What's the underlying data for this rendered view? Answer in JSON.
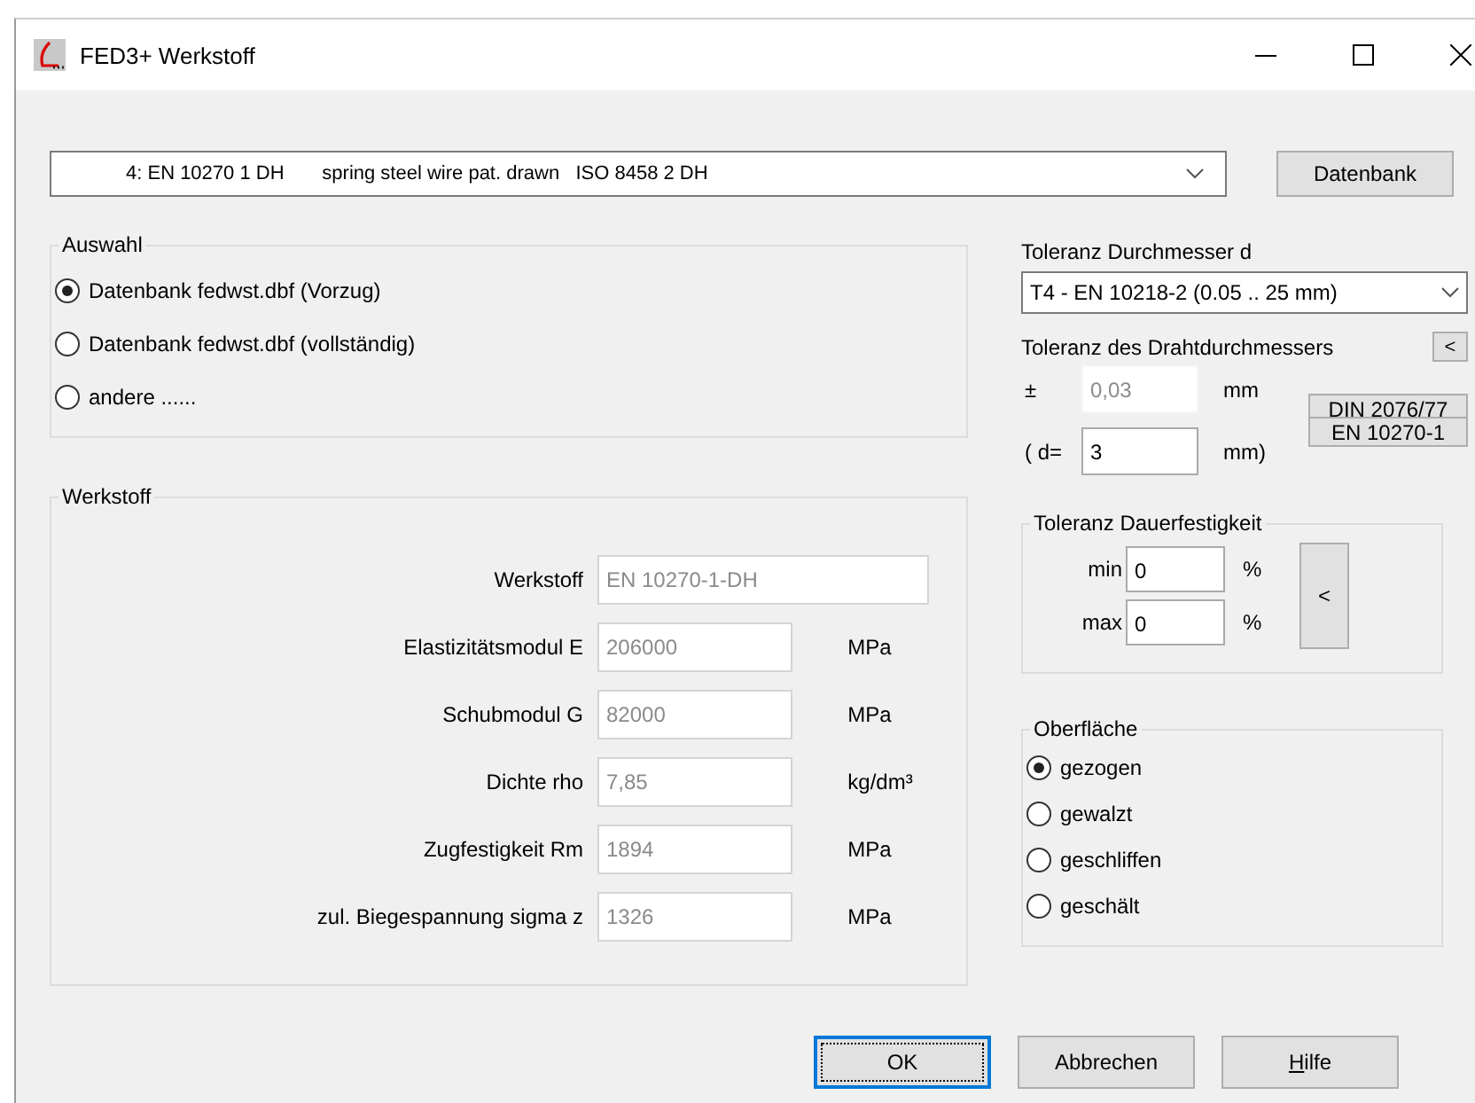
{
  "window": {
    "title": "FED3+ Werkstoff"
  },
  "material_combo": {
    "value": "4: EN 10270 1 DH       spring steel wire pat. drawn   ISO 8458 2 DH"
  },
  "database_button": "Datenbank",
  "auswahl": {
    "title": "Auswahl",
    "options": [
      {
        "label": "Datenbank fedwst.dbf (Vorzug)",
        "selected": true
      },
      {
        "label": "Datenbank fedwst.dbf (vollständig)",
        "selected": false
      },
      {
        "label": "andere ......",
        "selected": false
      }
    ]
  },
  "werkstoff": {
    "title": "Werkstoff",
    "fields": [
      {
        "label": "Werkstoff",
        "value": "EN 10270-1-DH",
        "disabled": true,
        "kind": "wide"
      },
      {
        "label": "Elastizitätsmodul E",
        "value": "206000",
        "unit": "MPa",
        "disabled": true,
        "kind": "unit"
      },
      {
        "label": "Schubmodul G",
        "value": "82000",
        "unit": "MPa",
        "disabled": true,
        "kind": "unit"
      },
      {
        "label": "Dichte rho",
        "value": "7,85",
        "unit": "kg/dm³",
        "disabled": true,
        "kind": "unit"
      },
      {
        "label": "Zugfestigkeit Rm",
        "value": "1894",
        "unit": "MPa",
        "disabled": true,
        "kind": "unit"
      },
      {
        "label": "zul. Biegespannung sigma z",
        "value": "1326",
        "unit": "MPa",
        "disabled": true,
        "kind": "unit"
      }
    ]
  },
  "toleranz_durchmesser": {
    "label": "Toleranz Durchmesser d",
    "value": "T4 - EN 10218-2 (0.05 .. 25 mm)"
  },
  "drahtdurchmesser": {
    "label": "Toleranz des Drahtdurchmessers",
    "back_button": "<",
    "plus_minus": "±",
    "tolerance_value": "0,03",
    "tolerance_disabled": true,
    "tolerance_unit": "mm",
    "d_label": "( d=",
    "d_value": "3",
    "d_unit": "mm)",
    "norm_buttons": [
      "DIN 2076/77",
      "EN 10270-1"
    ]
  },
  "dauerfestigkeit": {
    "title": "Toleranz Dauerfestigkeit",
    "rows": [
      {
        "label": "min",
        "value": "0",
        "unit": "%"
      },
      {
        "label": "max",
        "value": "0",
        "unit": "%"
      }
    ],
    "back_button": "<"
  },
  "oberflaeche": {
    "title": "Oberfläche",
    "options": [
      {
        "label": "gezogen",
        "selected": true
      },
      {
        "label": "gewalzt",
        "selected": false
      },
      {
        "label": "geschliffen",
        "selected": false
      },
      {
        "label": "geschält",
        "selected": false
      }
    ]
  },
  "buttons": [
    {
      "label": "OK",
      "focused": true,
      "underline_first": false
    },
    {
      "label": "Abbrechen",
      "focused": false,
      "underline_first": false
    },
    {
      "label": "Hilfe",
      "focused": false,
      "underline_first": true
    }
  ]
}
